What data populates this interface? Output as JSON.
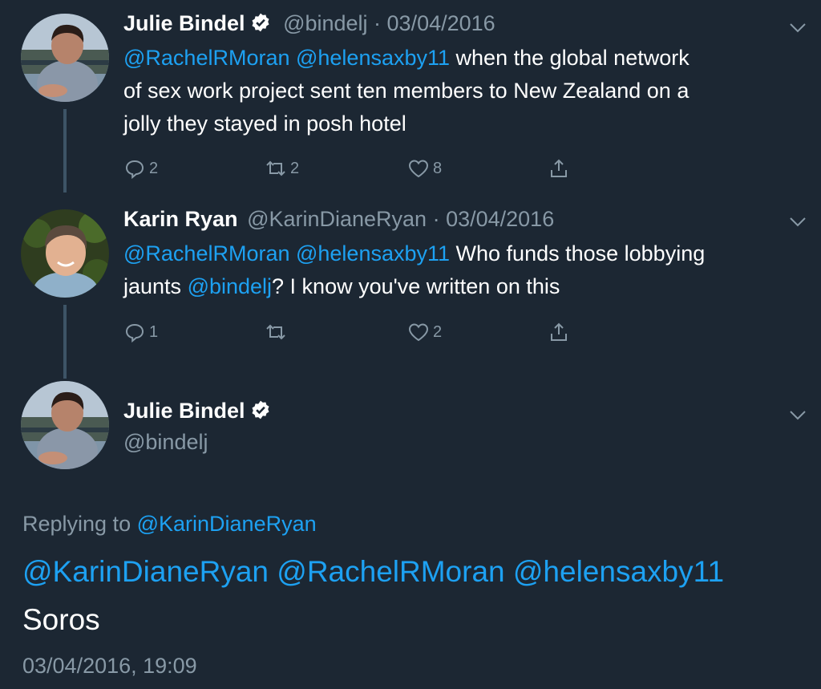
{
  "tweets": [
    {
      "name": "Julie Bindel",
      "handle": "@bindelj",
      "date": "03/04/2016",
      "mentions": "@RachelRMoran @helensaxby11",
      "text_line1": " when the global network",
      "text_line2": "of sex work project sent ten members to New Zealand on a",
      "text_line3": "jolly they stayed in posh hotel",
      "replies": "2",
      "retweets": "2",
      "likes": "8"
    },
    {
      "name": "Karin Ryan",
      "handle": "@KarinDianeRyan",
      "date": "03/04/2016",
      "mentions": "@RachelRMoran @helensaxby11",
      "text_after_mentions": " Who funds those lobbying",
      "text_line2_a": "jaunts ",
      "text_line2_mention": "@bindelj",
      "text_line2_b": "? I know you've written on this",
      "replies": "1",
      "retweets": "",
      "likes": "2"
    }
  ],
  "main_tweet": {
    "name": "Julie Bindel",
    "handle": "@bindelj",
    "replying_label": "Replying to ",
    "replying_to": "@KarinDianeRyan",
    "mentions": "@KarinDianeRyan @RachelRMoran @helensaxby11",
    "body": "Soros",
    "timestamp": "03/04/2016, 19:09"
  },
  "icons": [
    "reply-icon",
    "retweet-icon",
    "like-icon",
    "share-icon",
    "chevron-down-icon",
    "verified-icon"
  ],
  "colors": {
    "background": "#1c2733",
    "link": "#1da1f2",
    "muted": "#8899a6",
    "thread_line": "#3d5466"
  }
}
